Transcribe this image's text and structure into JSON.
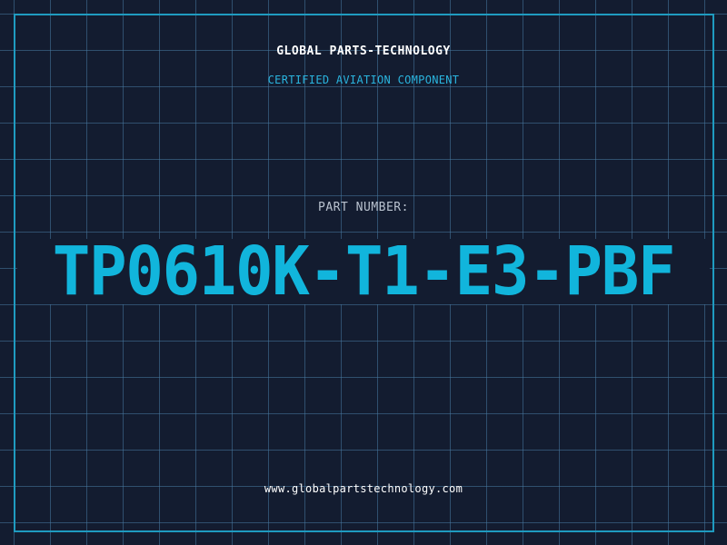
{
  "header": {
    "company": "GLOBAL PARTS-TECHNOLOGY",
    "tagline": "CERTIFIED AVIATION COMPONENT"
  },
  "part": {
    "label": "PART NUMBER:",
    "number": "TP0610K-T1-E3-PBF"
  },
  "footer": {
    "website": "www.globalpartstechnology.com"
  },
  "colors": {
    "background": "#131c30",
    "grid": "#46789f",
    "frame": "#1f9bc0",
    "accent": "#11b5dc",
    "text": "#ffffff",
    "label": "#b9c2cf"
  }
}
